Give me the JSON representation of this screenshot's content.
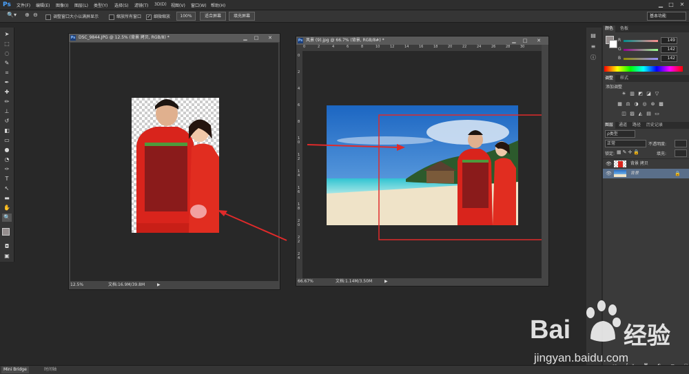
{
  "app": {
    "logo": "Ps"
  },
  "menu": [
    "文件(F)",
    "编辑(E)",
    "图像(I)",
    "图层(L)",
    "类型(Y)",
    "选择(S)",
    "滤镜(T)",
    "3D(D)",
    "视图(V)",
    "窗口(W)",
    "帮助(H)"
  ],
  "window_controls": {
    "minimize": "▁",
    "maximize": "□",
    "close": "✕"
  },
  "options": {
    "resize_windows": "调整窗口大小以满屏显示",
    "zoom_all": "缩放所有窗口",
    "scrubby_zoom": "细微缩放",
    "zoom_100": "100%",
    "fit_screen": "适合屏幕",
    "fill_screen": "填充屏幕",
    "workspace": "基本功能"
  },
  "doc1": {
    "title": "DSC_9844.JPG @ 12.5% (背景 拷贝, RGB/8) *",
    "zoom": "12.5%",
    "doc_size": "文档:16.9M/39.8M"
  },
  "doc2": {
    "title": "风景 (9).jpg @ 66.7% (背景, RGB/8#) *",
    "zoom": "66.67%",
    "doc_size": "文档:1.14M/3.50M",
    "top_ruler": [
      "0",
      "2",
      "4",
      "6",
      "8",
      "10",
      "12",
      "14",
      "16",
      "18",
      "20",
      "22",
      "24",
      "26",
      "28",
      "30"
    ],
    "left_ruler": [
      "0",
      "2",
      "4",
      "6",
      "8",
      "1 0",
      "1 2",
      "1 4",
      "1 6",
      "1 8",
      "2 0",
      "2 2",
      "2 4"
    ]
  },
  "color_panel": {
    "tabs": [
      "颜色",
      "色板"
    ],
    "r_label": "R",
    "r_value": "149",
    "g_label": "G",
    "g_value": "142",
    "b_label": "B",
    "b_value": "142"
  },
  "adjust_panel": {
    "tabs": [
      "调整",
      "样式"
    ],
    "title": "添加调整"
  },
  "layers_panel": {
    "tabs": [
      "图层",
      "通道",
      "路径",
      "历史记录"
    ],
    "filter": "ρ类型",
    "blend_mode": "正常",
    "opacity_label": "不透明度:",
    "lock_label": "锁定:",
    "fill_label": "填充:",
    "layers": [
      {
        "name": "背景 拷贝",
        "selected": false
      },
      {
        "name": "背景",
        "selected": true
      }
    ]
  },
  "bottom": {
    "mini_bridge": "Mini Bridge",
    "timeline": "时间轴"
  },
  "watermark": {
    "brand_left": "Bai",
    "brand_right": "经验",
    "url": "jingyan.baidu.com"
  },
  "colors": {
    "annotation_red": "#e02a2a",
    "selected_layer": "#5a6f8a"
  }
}
